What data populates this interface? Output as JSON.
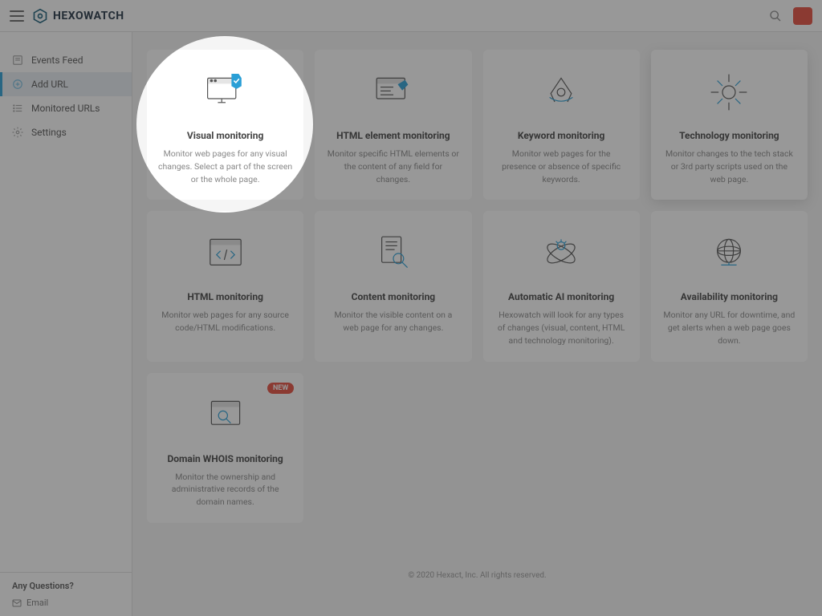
{
  "header": {
    "brand": "HEXOWATCH"
  },
  "sidebar": {
    "items": [
      {
        "label": "Events Feed"
      },
      {
        "label": "Add URL"
      },
      {
        "label": "Monitored URLs"
      },
      {
        "label": "Settings"
      }
    ],
    "footer": {
      "question": "Any Questions?",
      "email": "Email"
    }
  },
  "cards": [
    {
      "title": "Visual monitoring",
      "desc": "Monitor web pages for any visual changes. Select a part of the screen or the whole page."
    },
    {
      "title": "HTML element monitoring",
      "desc": "Monitor specific HTML elements or the content of any field for changes."
    },
    {
      "title": "Keyword monitoring",
      "desc": "Monitor web pages for the presence or absence of specific keywords."
    },
    {
      "title": "Technology monitoring",
      "desc": "Monitor changes to the tech stack or 3rd party scripts used on the web page."
    },
    {
      "title": "HTML monitoring",
      "desc": "Monitor web pages for any source code/HTML modifications."
    },
    {
      "title": "Content monitoring",
      "desc": "Monitor the visible content on a web page for any changes."
    },
    {
      "title": "Automatic AI monitoring",
      "desc": "Hexowatch will look for any types of changes (visual, content, HTML and technology monitoring)."
    },
    {
      "title": "Availability monitoring",
      "desc": "Monitor any URL for downtime, and get alerts when a web page goes down."
    },
    {
      "title": "Domain WHOIS monitoring",
      "desc": "Monitor the ownership and administrative records of the domain names.",
      "badge": "NEW"
    }
  ],
  "footer": "© 2020 Hexact, Inc. All rights reserved.",
  "colors": {
    "accent": "#2a9fd6",
    "danger": "#e74c3c"
  }
}
